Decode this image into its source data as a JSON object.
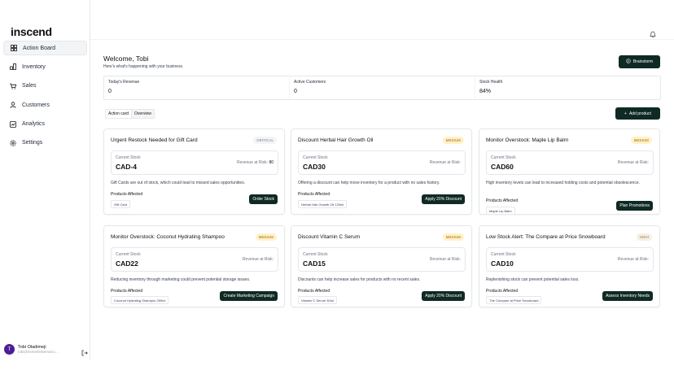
{
  "app": {
    "logo": "inscend"
  },
  "sidebar": {
    "items": [
      {
        "label": "Action Board",
        "icon": "grid-icon",
        "active": true
      },
      {
        "label": "Inventory",
        "icon": "inventory-icon",
        "active": false
      },
      {
        "label": "Sales",
        "icon": "cart-icon",
        "active": false
      },
      {
        "label": "Customers",
        "icon": "users-icon",
        "active": false
      },
      {
        "label": "Analytics",
        "icon": "chart-icon",
        "active": false
      },
      {
        "label": "Settings",
        "icon": "gear-icon",
        "active": false
      }
    ],
    "user": {
      "initial": "T",
      "name": "Tobi Oladimeji",
      "email": "tobi@rismelintlsemail.c..."
    }
  },
  "header": {
    "welcome": "Welcome, Tobi",
    "subtitle": "Here's what's happening with your business.",
    "brainstorm_label": "Brainstorm",
    "add_product_label": "Add product"
  },
  "stats": [
    {
      "label": "Today's Revenue",
      "value": "0"
    },
    {
      "label": "Active Customers",
      "value": "0"
    },
    {
      "label": "Stock Health",
      "value": "84%"
    }
  ],
  "tabs": [
    {
      "label": "Action card",
      "active": false
    },
    {
      "label": "Overview",
      "active": true
    }
  ],
  "cards": [
    {
      "title": "Urgent Restock Needed for Gift Card",
      "badge": "CRITICAL",
      "badge_type": "critical",
      "stock_label": "Current Stock",
      "stock_value": "CAD-4",
      "risk_label": "Revenue at Risk:",
      "risk_value": "80",
      "description": "Gift Cards are out of stock, which could lead to missed sales opportunities.",
      "products_label": "Products Affected",
      "product": "Gift Card",
      "action": "Order Stock"
    },
    {
      "title": "Discount Herbal Hair Growth Oil",
      "badge": "MEDIUM",
      "badge_type": "medium",
      "stock_label": "Current Stock",
      "stock_value": "CAD30",
      "risk_label": "Revenue at Risk:",
      "risk_value": "",
      "description": "Offering a discount can help move inventory for a product with no sales history.",
      "products_label": "Products Affected",
      "product": "Herbal Hair Growth Oil 120ml",
      "action": "Apply 20% Discount"
    },
    {
      "title": "Monitor Overstock: Maple Lip Balm",
      "badge": "MEDIUM",
      "badge_type": "medium",
      "stock_label": "Current Stock",
      "stock_value": "CAD60",
      "risk_label": "Revenue at Risk:",
      "risk_value": "",
      "description": "High inventory levels can lead to increased holding costs and potential obsolescence.",
      "products_label": "Products Affected",
      "product": "Maple Lip Balm",
      "action": "Plan Promotions"
    },
    {
      "title": "Monitor Overstock: Coconut Hydrating Shampoo",
      "badge": "MEDIUM",
      "badge_type": "medium",
      "stock_label": "Current Stock",
      "stock_value": "CAD22",
      "risk_label": "Revenue at Risk:",
      "risk_value": "",
      "description": "Reducing inventory through marketing could prevent potential storage issues.",
      "products_label": "Products Affected",
      "product": "Coconut Hydrating Shampoo 250ml",
      "action": "Create Marketing Campaign"
    },
    {
      "title": "Discount Vitamin C Serum",
      "badge": "MEDIUM",
      "badge_type": "medium",
      "stock_label": "Current Stock",
      "stock_value": "CAD15",
      "risk_label": "Revenue at Risk:",
      "risk_value": "",
      "description": "Discounts can help increase sales for products with no recent sales.",
      "products_label": "Products Affected",
      "product": "Vitamin C Serum 30ml",
      "action": "Apply 20% Discount"
    },
    {
      "title": "Low Stock Alert: The Compare at Price Snowboard",
      "badge": "HIGH",
      "badge_type": "high",
      "stock_label": "Current Stock",
      "stock_value": "CAD10",
      "risk_label": "Revenue at Risk:",
      "risk_value": "",
      "description": "Replenishing stock can prevent potential sales loss.",
      "products_label": "Products Affected",
      "product": "The Compare at Price Snowboard",
      "action": "Assess Inventory Needs"
    }
  ]
}
